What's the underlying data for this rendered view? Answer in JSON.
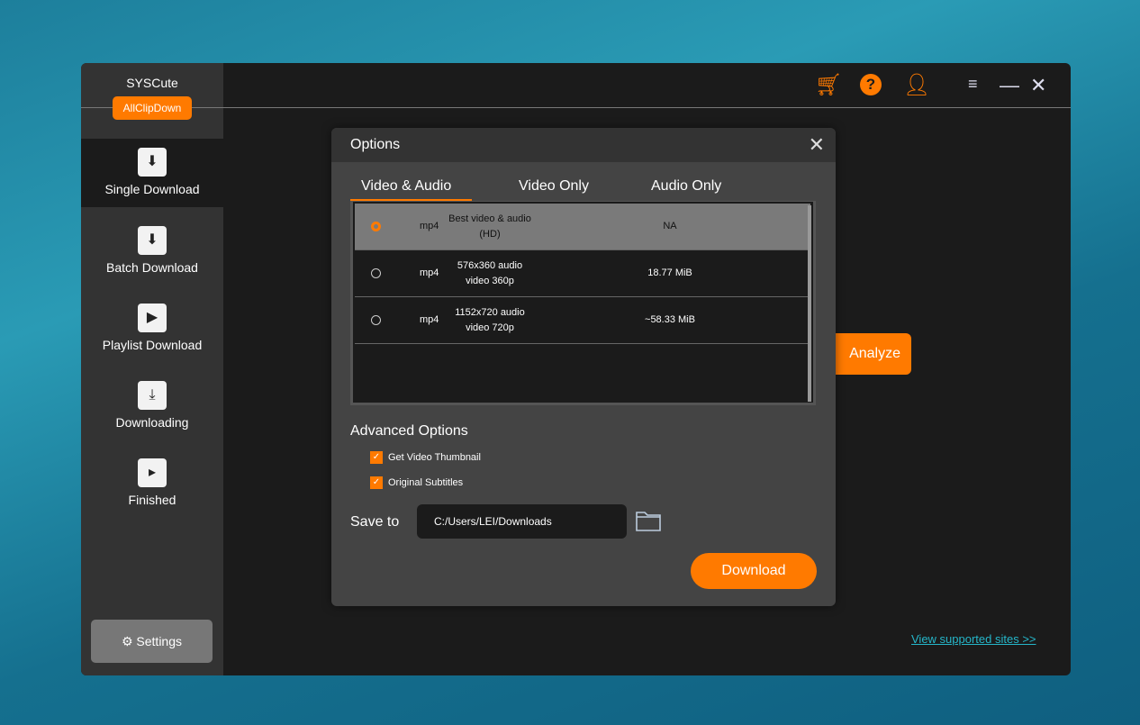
{
  "sidebar": {
    "brand": "SYSCute",
    "badge": "AllClipDown",
    "items": [
      {
        "label": "Single Download",
        "icon": "download-box-icon"
      },
      {
        "label": "Batch Download",
        "icon": "download-box-icon"
      },
      {
        "label": "Playlist Download",
        "icon": "play-icon"
      },
      {
        "label": "Downloading",
        "icon": "folder-download-icon"
      },
      {
        "label": "Finished",
        "icon": "film-icon"
      }
    ],
    "settings": "Settings"
  },
  "main": {
    "analyze": "Analyze",
    "link": "View supported sites >>"
  },
  "dialog": {
    "title": "Options",
    "tabs": [
      "Video & Audio",
      "Video Only",
      "Audio Only"
    ],
    "rows": [
      {
        "format": "mp4",
        "quality": "Best video & audio (HD)",
        "size": "NA",
        "selected": true
      },
      {
        "format": "mp4",
        "quality": "576x360 audio video 360p",
        "size": "18.77 MiB",
        "selected": false
      },
      {
        "format": "mp4",
        "quality": "1152x720 audio video 720p",
        "size": "~58.33 MiB",
        "selected": false
      }
    ],
    "advanced": "Advanced Options",
    "options": [
      {
        "label": "Get Video Thumbnail",
        "checked": true
      },
      {
        "label": "Original Subtitles",
        "checked": true
      }
    ],
    "save_label": "Save to",
    "save_path": "C:/Users/LEI/Downloads",
    "download": "Download"
  },
  "colors": {
    "accent": "#ff7a00",
    "link": "#25b6c9"
  }
}
